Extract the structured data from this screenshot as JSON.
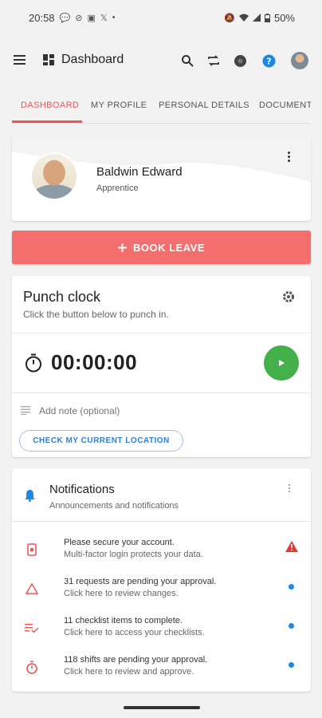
{
  "status_bar": {
    "time": "20:58",
    "battery": "50%",
    "dot": "•",
    "icons_left": [
      "chat-bubble-icon",
      "check-circle-icon",
      "linkedin-icon",
      "x-icon"
    ],
    "icons_right": [
      "mute-icon",
      "wifi-icon",
      "signal-icon",
      "battery-icon"
    ]
  },
  "app_bar": {
    "title": "Dashboard",
    "icons": [
      "menu-icon",
      "dashboard-icon",
      "search-icon",
      "sync-icon",
      "settings-icon",
      "help-icon",
      "avatar"
    ]
  },
  "tabs": [
    {
      "label": "DASHBOARD",
      "active": true
    },
    {
      "label": "MY PROFILE",
      "active": false
    },
    {
      "label": "PERSONAL DETAILS",
      "active": false
    },
    {
      "label": "DOCUMENTS",
      "active": false
    }
  ],
  "profile": {
    "name": "Baldwin Edward",
    "role": "Apprentice"
  },
  "book_leave": {
    "label": "BOOK LEAVE",
    "icon": "plus-icon"
  },
  "punch_clock": {
    "title": "Punch clock",
    "subtitle": "Click the button below to punch in.",
    "timer": "00:00:00",
    "note_placeholder": "Add note (optional)",
    "location_button": "CHECK MY CURRENT LOCATION"
  },
  "notifications": {
    "title": "Notifications",
    "subtitle": "Announcements and notifications",
    "items": [
      {
        "line1": "Please secure your account.",
        "line2": "Multi-factor login protects your data.",
        "icon": "phone-lock-icon",
        "indicator": "warning"
      },
      {
        "line1": "31 requests are pending your approval.",
        "line2": "Click here to review changes.",
        "icon": "triangle-alert-icon",
        "indicator": "dot"
      },
      {
        "line1": "11 checklist items to complete.",
        "line2": "Click here to access your checklists.",
        "icon": "checklist-icon",
        "indicator": "dot"
      },
      {
        "line1": "118 shifts are pending your approval.",
        "line2": "Click here to review and approve.",
        "icon": "stopwatch-icon",
        "indicator": "dot"
      }
    ]
  },
  "colors": {
    "accent_red": "#e95757",
    "book_button": "#f56e6e",
    "play_green": "#43b04a",
    "link_blue": "#2f80d6",
    "dot_blue": "#1e88e5"
  }
}
